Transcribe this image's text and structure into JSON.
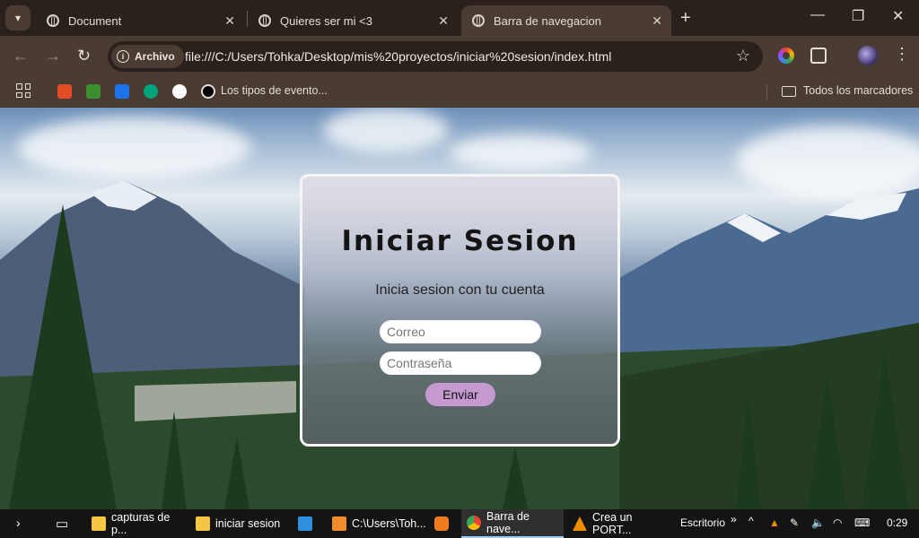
{
  "browser": {
    "tabs": [
      {
        "title": "Document",
        "active": false
      },
      {
        "title": "Quieres ser mi <3",
        "active": false
      },
      {
        "title": "Barra de navegacion",
        "active": true
      }
    ],
    "address": {
      "chip_label": "Archivo",
      "url": "file:///C:/Users/Tohka/Desktop/mis%20proyectos/iniciar%20sesion/index.html"
    },
    "bookmarks": {
      "items": [
        {
          "label": "",
          "icon": "html-icon",
          "color": "#e34c26"
        },
        {
          "label": "",
          "icon": "lambda-icon",
          "color": "#3c8d2f"
        },
        {
          "label": "",
          "icon": "formula-icon",
          "color": "#1a73e8"
        },
        {
          "label": "",
          "icon": "arrow-badge-icon",
          "color": "#00a37a"
        },
        {
          "label": "",
          "icon": "panda-icon",
          "color": "#ffffff"
        },
        {
          "label": "Los tipos de evento...",
          "icon": "swirl-icon",
          "color": "#000000"
        }
      ],
      "all_label": "Todos los marcadores"
    }
  },
  "page": {
    "title": "Iniciar Sesion",
    "subtitle": "Inicia sesion con tu cuenta",
    "email_placeholder": "Correo",
    "password_placeholder": "Contraseña",
    "submit_label": "Enviar",
    "submit_color": "#c59ad1"
  },
  "taskbar": {
    "items": [
      {
        "label": "capturas de p...",
        "icon": "folder-icon",
        "color": "#f3c645"
      },
      {
        "label": "iniciar sesion",
        "icon": "folder-icon",
        "color": "#f3c645"
      },
      {
        "label": "",
        "icon": "vscode-icon",
        "color": "#2f8ee0"
      },
      {
        "label": "C:\\Users\\Toh...",
        "icon": "sublime-icon",
        "color": "#f08c2e"
      },
      {
        "label": "",
        "icon": "media-icon",
        "color": "#f07b1e"
      },
      {
        "label": "Barra de nave...",
        "icon": "chrome-icon",
        "color": "#4285f4"
      },
      {
        "label": "Crea un PORT...",
        "icon": "vlc-icon",
        "color": "#f08c00"
      }
    ],
    "desktop_label": "Escritorio",
    "time": "0:29"
  }
}
